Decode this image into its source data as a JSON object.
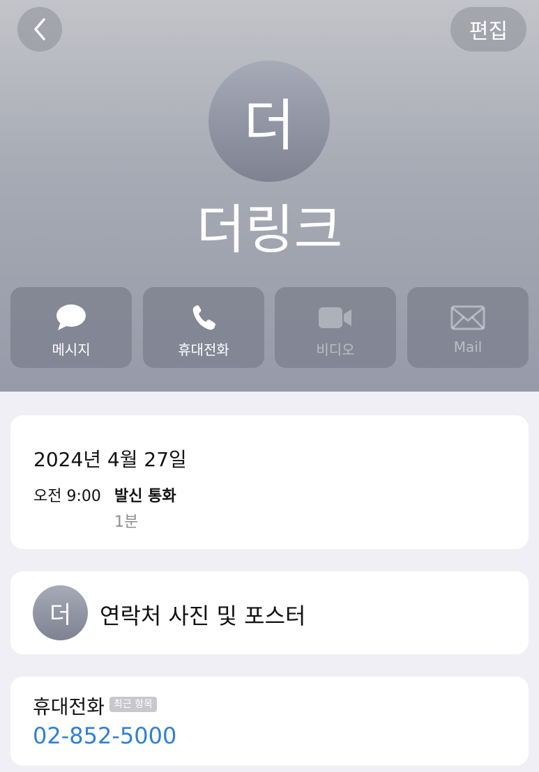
{
  "nav": {
    "back_icon": "chevron-left-icon",
    "edit_label": "편집"
  },
  "contact": {
    "avatar_initial": "더",
    "name": "더링크"
  },
  "actions": [
    {
      "label": "메시지",
      "icon": "message-bubble-icon",
      "enabled": true
    },
    {
      "label": "휴대전화",
      "icon": "phone-icon",
      "enabled": true
    },
    {
      "label": "비디오",
      "icon": "video-camera-icon",
      "enabled": false
    },
    {
      "label": "Mail",
      "icon": "mail-envelope-icon",
      "enabled": false
    }
  ],
  "call_log": {
    "date": "2024년 4월 27일",
    "time": "오전 9:00",
    "type": "발신 통화",
    "duration": "1분"
  },
  "poster": {
    "avatar_initial": "더",
    "label": "연락처 사진 및 포스터"
  },
  "phone": {
    "label": "휴대전화",
    "badge": "최근 항목",
    "number": "02-852-5000",
    "number_color": "#2f7fd9"
  },
  "colors": {
    "header_gradient_top": "#c3c4c9",
    "header_gradient_bottom": "#979aa8",
    "background": "#f0eff5"
  }
}
